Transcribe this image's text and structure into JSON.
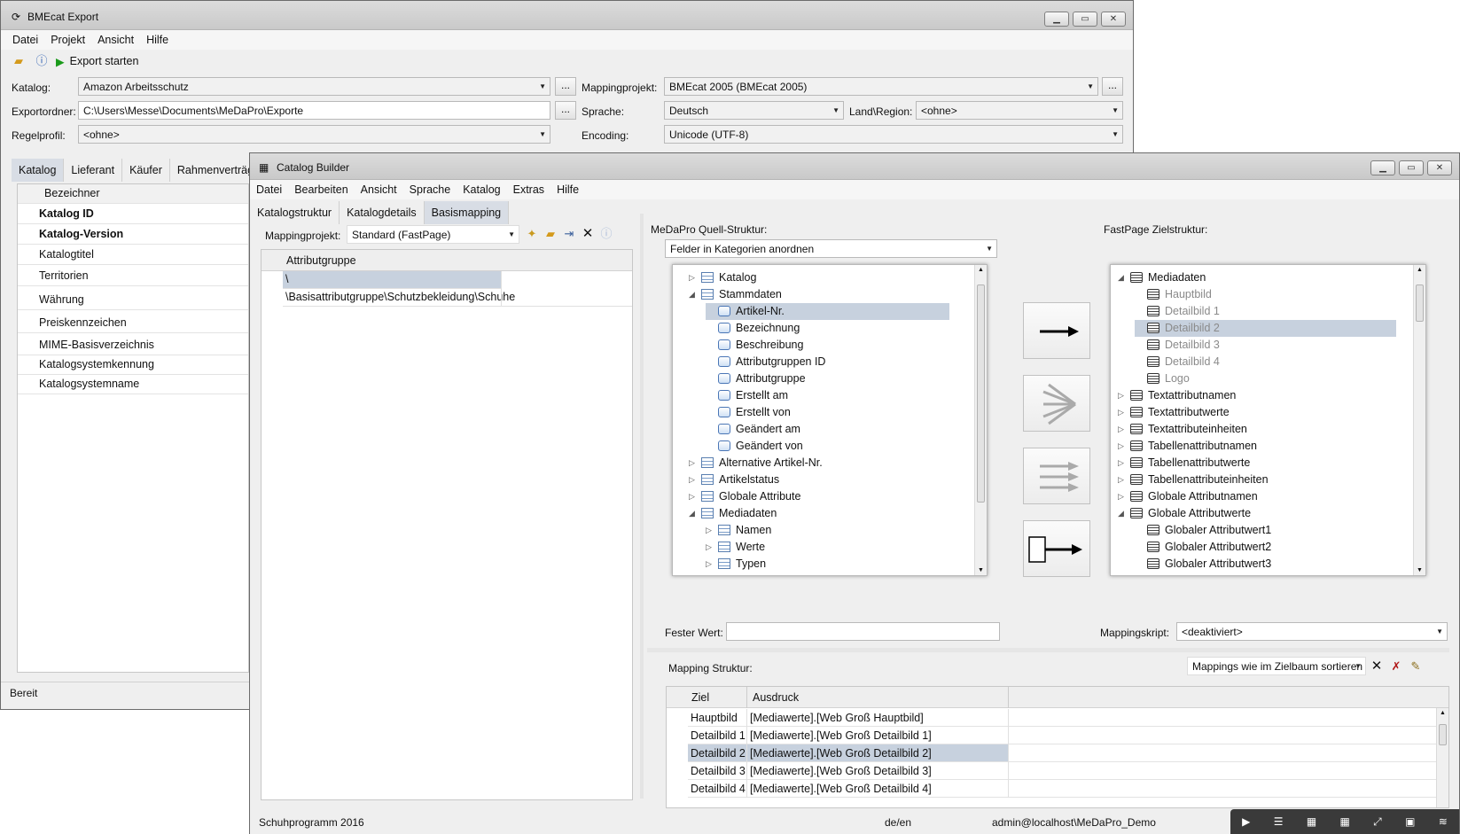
{
  "export_window": {
    "title": "BMEcat Export",
    "menu": [
      "Datei",
      "Projekt",
      "Ansicht",
      "Hilfe"
    ],
    "toolbar": {
      "export_label": "Export starten"
    },
    "fields": {
      "katalog_label": "Katalog:",
      "katalog_value": "Amazon Arbeitsschutz",
      "exportordner_label": "Exportordner:",
      "exportordner_value": "C:\\Users\\Messe\\Documents\\MeDaPro\\Exporte",
      "regelprofil_label": "Regelprofil:",
      "regelprofil_value": "<ohne>",
      "mappingprojekt_label": "Mappingprojekt:",
      "mappingprojekt_value": "BMEcat 2005 (BMEcat 2005)",
      "sprache_label": "Sprache:",
      "sprache_value": "Deutsch",
      "land_label": "Land\\Region:",
      "land_value": "<ohne>",
      "encoding_label": "Encoding:",
      "encoding_value": "Unicode (UTF-8)",
      "dots": "..."
    },
    "tabs": [
      "Katalog",
      "Lieferant",
      "Käufer",
      "Rahmenverträge"
    ],
    "grid_header": "Bezeichner",
    "rows": [
      "Katalog ID",
      "Katalog-Version",
      "Katalogtitel",
      "Territorien",
      "Währung",
      "Preiskennzeichen",
      "MIME-Basisverzeichnis",
      "Katalogsystemkennung",
      "Katalogsystemname"
    ],
    "status": "Bereit"
  },
  "builder_window": {
    "title": "Catalog Builder",
    "menu": [
      "Datei",
      "Bearbeiten",
      "Ansicht",
      "Sprache",
      "Katalog",
      "Extras",
      "Hilfe"
    ],
    "tabs": [
      "Katalogstruktur",
      "Katalogdetails",
      "Basismapping"
    ],
    "mappingprojekt_label": "Mappingprojekt:",
    "mappingprojekt_value": "Standard (FastPage)",
    "attr_header": "Attributgruppe",
    "attr_rows": [
      "\\",
      "\\Basisattributgruppe\\Schutzbekleidung\\Schuhe"
    ],
    "source_label": "MeDaPro Quell-Struktur:",
    "source_combo": "Felder in Kategorien anordnen",
    "target_label": "FastPage Zielstruktur:",
    "source_tree": [
      {
        "t": "Katalog",
        "lvl": 0,
        "exp": "▷",
        "icon": "table"
      },
      {
        "t": "Stammdaten",
        "lvl": 0,
        "exp": "◢",
        "icon": "table"
      },
      {
        "t": "Artikel-Nr.",
        "lvl": 1,
        "exp": "",
        "icon": "field",
        "sel": true
      },
      {
        "t": "Bezeichnung",
        "lvl": 1,
        "exp": "",
        "icon": "field"
      },
      {
        "t": "Beschreibung",
        "lvl": 1,
        "exp": "",
        "icon": "field"
      },
      {
        "t": "Attributgruppen ID",
        "lvl": 1,
        "exp": "",
        "icon": "field"
      },
      {
        "t": "Attributgruppe",
        "lvl": 1,
        "exp": "",
        "icon": "field"
      },
      {
        "t": "Erstellt am",
        "lvl": 1,
        "exp": "",
        "icon": "field"
      },
      {
        "t": "Erstellt von",
        "lvl": 1,
        "exp": "",
        "icon": "field"
      },
      {
        "t": "Geändert am",
        "lvl": 1,
        "exp": "",
        "icon": "field"
      },
      {
        "t": "Geändert von",
        "lvl": 1,
        "exp": "",
        "icon": "field"
      },
      {
        "t": "Alternative Artikel-Nr.",
        "lvl": 0,
        "exp": "▷",
        "icon": "table"
      },
      {
        "t": "Artikelstatus",
        "lvl": 0,
        "exp": "▷",
        "icon": "table"
      },
      {
        "t": "Globale Attribute",
        "lvl": 0,
        "exp": "▷",
        "icon": "table"
      },
      {
        "t": "Mediadaten",
        "lvl": 0,
        "exp": "◢",
        "icon": "table"
      },
      {
        "t": "Namen",
        "lvl": 1,
        "exp": "▷",
        "icon": "table"
      },
      {
        "t": "Werte",
        "lvl": 1,
        "exp": "▷",
        "icon": "table"
      },
      {
        "t": "Typen",
        "lvl": 1,
        "exp": "▷",
        "icon": "table"
      }
    ],
    "target_tree": [
      {
        "t": "Mediadaten",
        "lvl": 0,
        "exp": "◢"
      },
      {
        "t": "Hauptbild",
        "lvl": 1,
        "exp": "",
        "grey": true
      },
      {
        "t": "Detailbild 1",
        "lvl": 1,
        "exp": "",
        "grey": true
      },
      {
        "t": "Detailbild 2",
        "lvl": 1,
        "exp": "",
        "grey": true,
        "sel": true
      },
      {
        "t": "Detailbild 3",
        "lvl": 1,
        "exp": "",
        "grey": true
      },
      {
        "t": "Detailbild 4",
        "lvl": 1,
        "exp": "",
        "grey": true
      },
      {
        "t": "Logo",
        "lvl": 1,
        "exp": "",
        "grey": true
      },
      {
        "t": "Textattributnamen",
        "lvl": 0,
        "exp": "▷"
      },
      {
        "t": "Textattributwerte",
        "lvl": 0,
        "exp": "▷"
      },
      {
        "t": "Textattributeinheiten",
        "lvl": 0,
        "exp": "▷"
      },
      {
        "t": "Tabellenattributnamen",
        "lvl": 0,
        "exp": "▷"
      },
      {
        "t": "Tabellenattributwerte",
        "lvl": 0,
        "exp": "▷"
      },
      {
        "t": "Tabellenattributeinheiten",
        "lvl": 0,
        "exp": "▷"
      },
      {
        "t": "Globale Attributnamen",
        "lvl": 0,
        "exp": "▷"
      },
      {
        "t": "Globale Attributwerte",
        "lvl": 0,
        "exp": "◢"
      },
      {
        "t": "Globaler Attributwert1",
        "lvl": 1,
        "exp": ""
      },
      {
        "t": "Globaler Attributwert2",
        "lvl": 1,
        "exp": ""
      },
      {
        "t": "Globaler Attributwert3",
        "lvl": 1,
        "exp": ""
      }
    ],
    "fester_wert_label": "Fester Wert:",
    "mappingskript_label": "Mappingskript:",
    "mappingskript_value": "<deaktiviert>",
    "mapping_struktur_label": "Mapping Struktur:",
    "sort_combo": "Mappings wie im Zielbaum sortieren",
    "mapping_headers": [
      "Ziel",
      "Ausdruck"
    ],
    "mapping_rows": [
      {
        "ziel": "Hauptbild",
        "ausdruck": "[Mediawerte].[Web Groß Hauptbild]"
      },
      {
        "ziel": "Detailbild 1",
        "ausdruck": "[Mediawerte].[Web Groß Detailbild 1]"
      },
      {
        "ziel": "Detailbild 2",
        "ausdruck": "[Mediawerte].[Web Groß Detailbild 2]",
        "sel": true
      },
      {
        "ziel": "Detailbild 3",
        "ausdruck": "[Mediawerte].[Web Groß Detailbild 3]"
      },
      {
        "ziel": "Detailbild 4",
        "ausdruck": "[Mediawerte].[Web Groß Detailbild 4]"
      }
    ],
    "status": {
      "left": "Schuhprogramm 2016",
      "lang": "de/en",
      "user": "admin@localhost\\MeDaPro_Demo"
    }
  },
  "colors": {
    "selection": "#c7d1de",
    "active_tab": "#d8dde5",
    "titlebar": "#d2d2d2"
  }
}
